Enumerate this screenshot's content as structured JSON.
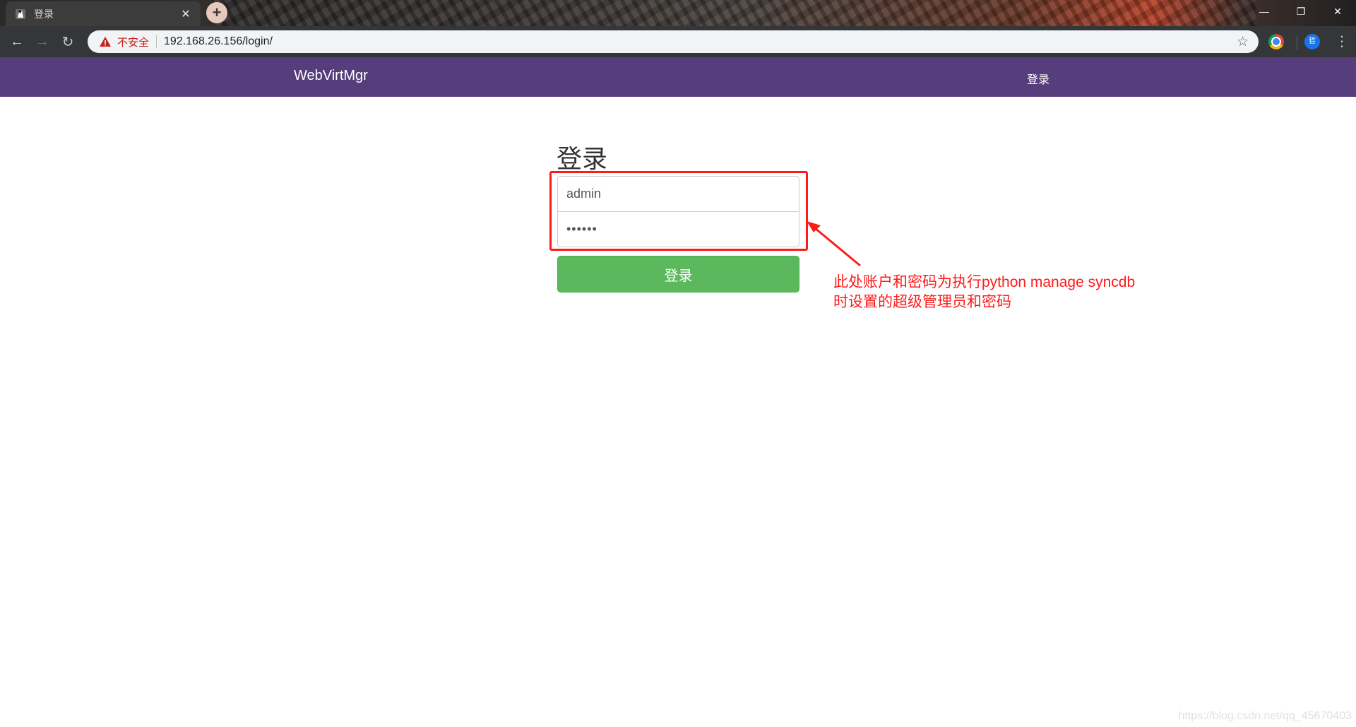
{
  "browser": {
    "tab": {
      "title": "登录",
      "close_glyph": "✕",
      "favicon": "django-pony-icon"
    },
    "new_tab_glyph": "+",
    "window_controls": {
      "minimize": "—",
      "restore": "❐",
      "close": "✕"
    },
    "nav": {
      "back": "←",
      "forward": "→",
      "reload": "↻"
    },
    "omnibox": {
      "security_label": "不安全",
      "url": "192.168.26.156/login/",
      "star": "☆"
    },
    "profile_initial": "哲",
    "menu": "⋮"
  },
  "navbar": {
    "brand": "WebVirtMgr",
    "login_link": "登录",
    "background": "#563d7c"
  },
  "login_form": {
    "heading": "登录",
    "username_value": "admin",
    "password_value": "••••••",
    "submit_label": "登录",
    "button_color": "#5cb85c"
  },
  "annotation": {
    "line1": "此处账户和密码为执行python manage syncdb",
    "line2": "时设置的超级管理员和密码",
    "color": "#ff1a1a"
  },
  "watermark": "https://blog.csdn.net/qq_45670403"
}
